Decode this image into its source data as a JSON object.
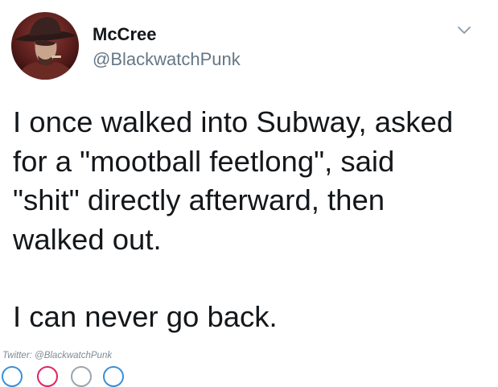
{
  "tweet": {
    "author": {
      "display_name": "McCree",
      "handle": "@BlackwatchPunk",
      "avatar_icon": "avatar-portrait-icon"
    },
    "menu_icon": "chevron-down-icon",
    "text_paragraphs": [
      {
        "lines": [
          "I once walked into Subway, asked",
          "for a \"mootball feetlong\", said",
          "\"shit\" directly afterward, then",
          "walked out."
        ]
      },
      {
        "lines": [
          "I can never go back."
        ]
      }
    ]
  },
  "watermark": "Twitter: @BlackwatchPunk",
  "colors": {
    "text": "#14171a",
    "handle": "#657786",
    "watermark": "#7f8a94",
    "avatar_bg": "#5a1e1c"
  },
  "action_bar": {
    "icons": [
      "reply-icon",
      "retweet-icon",
      "like-icon",
      "share-icon"
    ],
    "accent_colors": [
      "#3b8fd6",
      "#e0245e",
      "#9aa5ae",
      "#3b8fd6"
    ]
  }
}
